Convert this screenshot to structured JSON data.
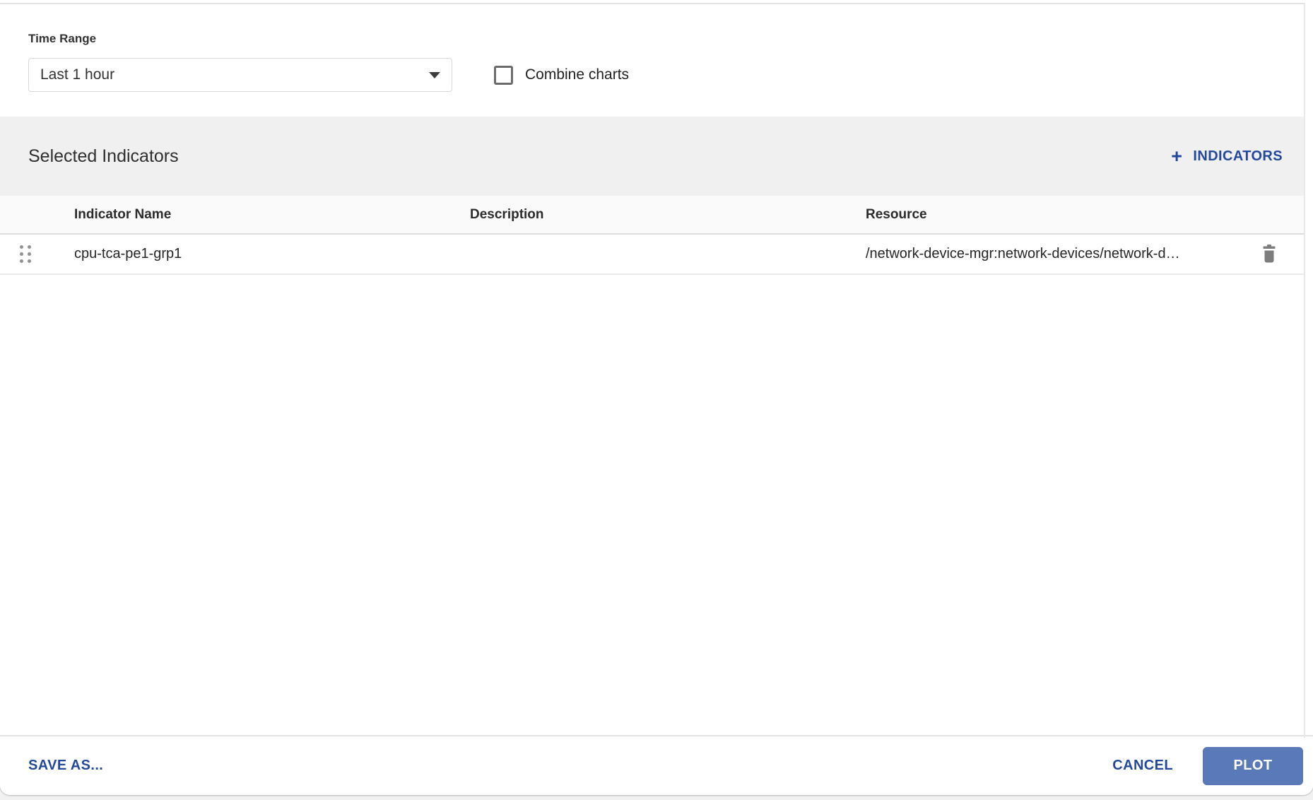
{
  "time_range": {
    "label": "Time Range",
    "value": "Last 1 hour"
  },
  "combine_charts": {
    "label": "Combine charts",
    "checked": false
  },
  "selected_indicators": {
    "title": "Selected Indicators",
    "add_button_label": "INDICATORS",
    "add_button_icon": "plus-icon"
  },
  "table": {
    "columns": [
      "Indicator Name",
      "Description",
      "Resource"
    ],
    "rows": [
      {
        "indicator_name": "cpu-tca-pe1-grp1",
        "description": "",
        "resource": "/network-device-mgr:network-devices/network-d…",
        "row_icons": [
          "drag-handle-icon",
          "trash-icon"
        ]
      }
    ]
  },
  "footer": {
    "save_as_label": "SAVE AS...",
    "cancel_label": "CANCEL",
    "plot_label": "PLOT"
  },
  "colors": {
    "accent_blue": "#24499c",
    "plot_button_bg": "#5a79b9",
    "plot_button_text": "#ffffff",
    "section_bar_bg": "#f0f0f0",
    "table_header_bg": "#fafafa"
  }
}
